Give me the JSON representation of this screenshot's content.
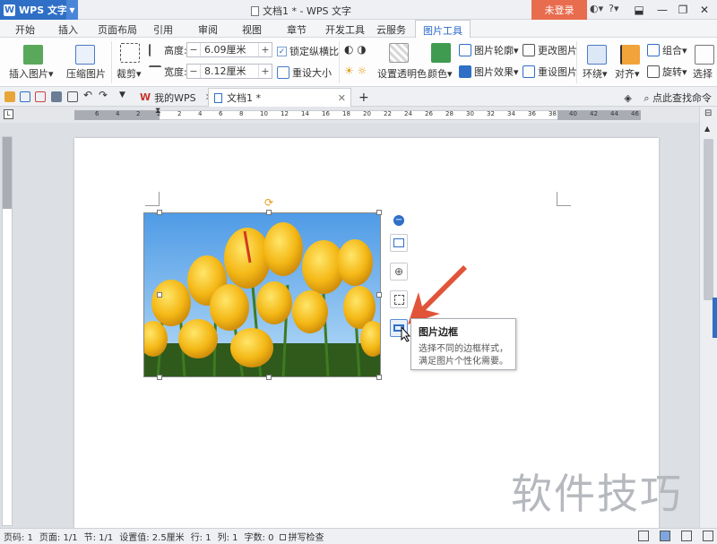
{
  "titlebar": {
    "app_name": "WPS 文字",
    "app_logo": "W",
    "window_title": "文档1 * - WPS 文字",
    "login_label": "未登录",
    "minimize": "—",
    "restore": "❐",
    "close": "✕"
  },
  "menu": {
    "tabs": [
      "开始",
      "插入",
      "页面布局",
      "引用",
      "审阅",
      "视图",
      "章节",
      "开发工具",
      "云服务",
      "图片工具"
    ],
    "active_tab": "图片工具"
  },
  "ribbon": {
    "insert_picture": "插入图片",
    "compress_picture": "压缩图片",
    "crop": "裁剪",
    "height_label": "高度:",
    "height_value": "6.09厘米",
    "width_label": "宽度:",
    "width_value": "8.12厘米",
    "lock_ratio": "锁定纵横比",
    "reset_size": "重设大小",
    "set_transparent": "设置透明色",
    "color": "颜色",
    "picture_outline": "图片轮廓",
    "picture_effects": "图片效果",
    "change_picture": "更改图片",
    "reset_picture": "重设图片",
    "wrap": "环绕",
    "align": "对齐",
    "group": "组合",
    "rotate": "旋转",
    "select": "选择"
  },
  "quickbar": {
    "tab_mywps": "我的WPS",
    "tab_doc": "文档1 *",
    "new_tab": "+",
    "search_cmd": "点此查找命令"
  },
  "ruler": {
    "ticks": [
      "6",
      "4",
      "2",
      "2",
      "2",
      "4",
      "6",
      "8",
      "10",
      "12",
      "14",
      "16",
      "18",
      "20",
      "22",
      "24",
      "26",
      "28",
      "30",
      "32",
      "34",
      "36",
      "38",
      "40",
      "42",
      "44",
      "46"
    ]
  },
  "tooltip": {
    "title": "图片边框",
    "desc_line1": "选择不同的边框样式，",
    "desc_line2": "满足图片个性化需要。"
  },
  "watermark": "软件技巧",
  "statusbar": {
    "page_code": "页码: 1",
    "pages": "页面: 1/1",
    "section": "节: 1/1",
    "setting": "设置值: 2.5厘米",
    "row": "行: 1",
    "col": "列: 1",
    "words": "字数: 0",
    "spell": "拼写检查"
  },
  "colors": {
    "accent_blue": "#2f6fc6",
    "login_orange": "#e86c4e",
    "arrow_red": "#e0553a"
  }
}
